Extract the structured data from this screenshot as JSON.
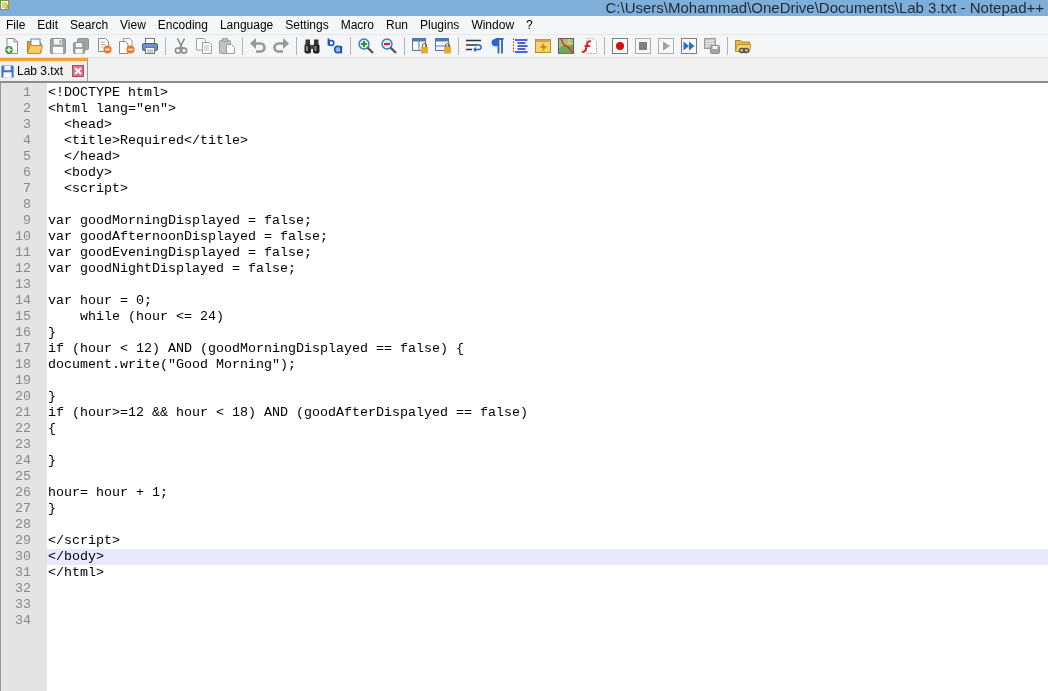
{
  "window": {
    "title": "C:\\Users\\Mohammad\\OneDrive\\Documents\\Lab 3.txt - Notepad++"
  },
  "menu": [
    "File",
    "Edit",
    "Search",
    "View",
    "Encoding",
    "Language",
    "Settings",
    "Macro",
    "Run",
    "Plugins",
    "Window",
    "?"
  ],
  "toolbar": [
    [
      {
        "kind": "new",
        "disabled": false
      },
      {
        "kind": "open",
        "disabled": false
      },
      {
        "kind": "save",
        "disabled": true
      },
      {
        "kind": "saveall",
        "disabled": true
      },
      {
        "kind": "close",
        "disabled": false
      },
      {
        "kind": "closeall",
        "disabled": false
      },
      {
        "kind": "print",
        "disabled": false
      }
    ],
    [
      {
        "kind": "cut",
        "disabled": true
      },
      {
        "kind": "copy",
        "disabled": true
      },
      {
        "kind": "paste",
        "disabled": true
      }
    ],
    [
      {
        "kind": "undo",
        "disabled": true
      },
      {
        "kind": "redo",
        "disabled": true
      }
    ],
    [
      {
        "kind": "find",
        "disabled": false
      },
      {
        "kind": "replace",
        "disabled": false
      }
    ],
    [
      {
        "kind": "zoomin",
        "disabled": false
      },
      {
        "kind": "zoomout",
        "disabled": false
      }
    ],
    [
      {
        "kind": "syncv",
        "disabled": false
      },
      {
        "kind": "synch",
        "disabled": false
      }
    ],
    [
      {
        "kind": "wrap",
        "disabled": false
      },
      {
        "kind": "allchars",
        "disabled": false
      },
      {
        "kind": "indent",
        "disabled": false
      },
      {
        "kind": "udl",
        "disabled": false
      },
      {
        "kind": "docmap",
        "disabled": false
      },
      {
        "kind": "funclist",
        "disabled": false
      }
    ],
    [
      {
        "kind": "record",
        "disabled": false
      },
      {
        "kind": "stop",
        "disabled": true
      },
      {
        "kind": "play",
        "disabled": true
      },
      {
        "kind": "playmulti",
        "disabled": false
      },
      {
        "kind": "savemacro",
        "disabled": true
      }
    ],
    [
      {
        "kind": "workspace",
        "disabled": false
      }
    ]
  ],
  "tabs": [
    {
      "label": "Lab 3.txt",
      "selected": true,
      "modified": false
    }
  ],
  "editor": {
    "lines": [
      {
        "number": "1",
        "text": "<!DOCTYPE html>",
        "current": false
      },
      {
        "number": "2",
        "text": "<html lang=\"en\">",
        "current": false
      },
      {
        "number": "3",
        "text": "  <head>",
        "current": false
      },
      {
        "number": "4",
        "text": "  <title>Required</title>",
        "current": false
      },
      {
        "number": "5",
        "text": "  </head>",
        "current": false
      },
      {
        "number": "6",
        "text": "  <body>",
        "current": false
      },
      {
        "number": "7",
        "text": "  <script>",
        "current": false
      },
      {
        "number": "8",
        "current": false
      },
      {
        "number": "9",
        "text": "var goodMorningDisplayed = false;",
        "current": false
      },
      {
        "number": "10",
        "text": "var goodAfternoonDisplayed = false;",
        "current": false
      },
      {
        "number": "11",
        "text": "var goodEveningDisplayed = false;",
        "current": false
      },
      {
        "number": "12",
        "text": "var goodNightDisplayed = false;",
        "current": false
      },
      {
        "number": "13",
        "current": false
      },
      {
        "number": "14",
        "text": "var hour = 0;",
        "current": false
      },
      {
        "number": "15",
        "text": "    while (hour <= 24)",
        "current": false
      },
      {
        "number": "16",
        "text": "}",
        "current": false
      },
      {
        "number": "17",
        "text": "if (hour < 12) AND (goodMorningDisplayed == false) {",
        "current": false
      },
      {
        "number": "18",
        "text": "document.write(\"Good Morning\");",
        "current": false
      },
      {
        "number": "19",
        "current": false
      },
      {
        "number": "20",
        "text": "}",
        "current": false
      },
      {
        "number": "21",
        "text": "if (hour>=12 && hour < 18) AND (goodAfterDispalyed == false)",
        "current": false
      },
      {
        "number": "22",
        "text": "{",
        "current": false
      },
      {
        "number": "23",
        "current": false
      },
      {
        "number": "24",
        "text": "}",
        "current": false
      },
      {
        "number": "25",
        "current": false
      },
      {
        "number": "26",
        "text": "hour= hour + 1;",
        "current": false
      },
      {
        "number": "27",
        "text": "}",
        "current": false
      },
      {
        "number": "28",
        "current": false
      },
      {
        "number": "29",
        "text": "</script>",
        "current": false
      },
      {
        "number": "30",
        "text": "</body>",
        "current": true
      },
      {
        "number": "31",
        "text": "</html>",
        "current": false
      },
      {
        "number": "32",
        "current": false
      },
      {
        "number": "33",
        "current": false
      },
      {
        "number": "34",
        "current": false
      }
    ]
  }
}
